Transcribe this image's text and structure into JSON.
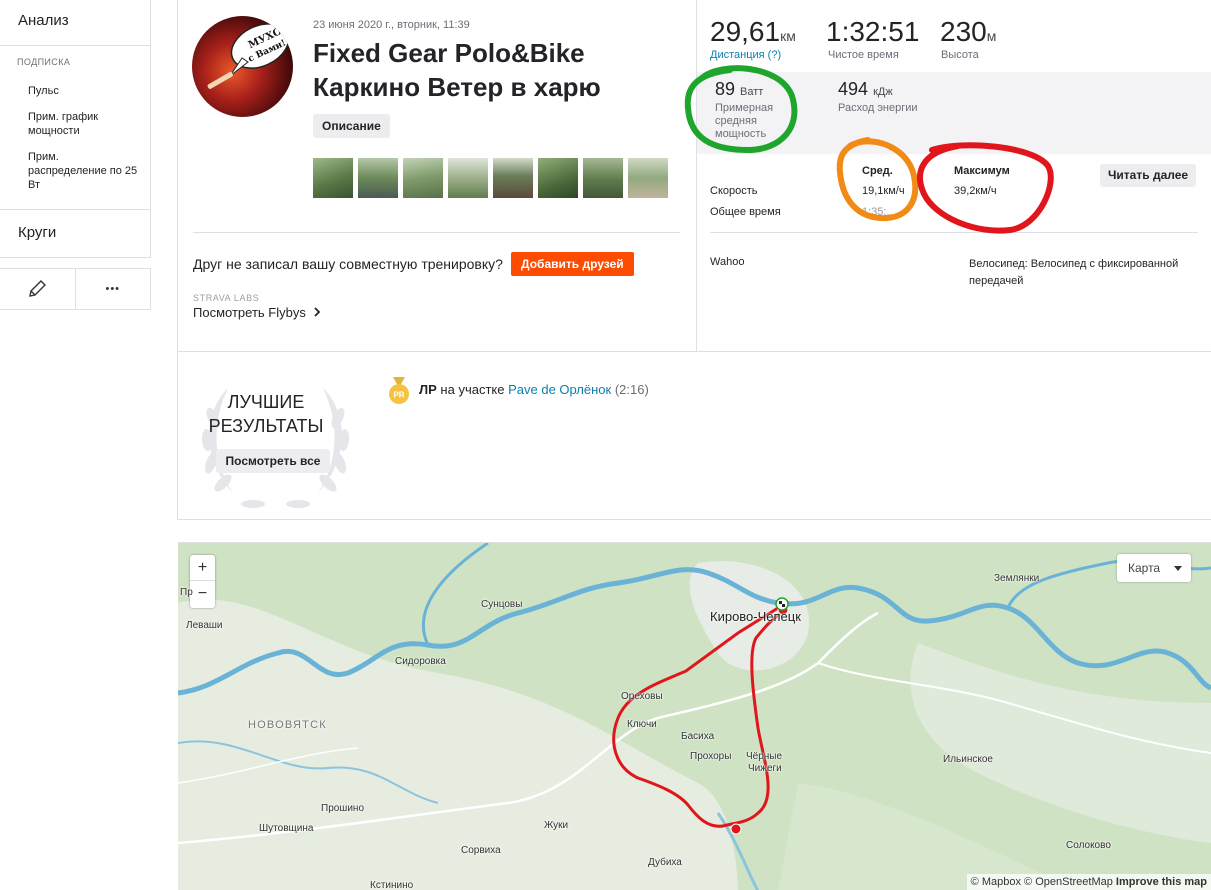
{
  "sidebar": {
    "analysis": "Анализ",
    "subscription_section": "ПОДПИСКА",
    "items": [
      {
        "label": "Пульс"
      },
      {
        "label": "Прим. график мощности"
      },
      {
        "label": "Прим. распределение по 25 Вт"
      }
    ],
    "laps": "Круги",
    "edit_icon": "pencil-icon",
    "more_icon": "ellipsis-icon",
    "more_text": "•••"
  },
  "activity": {
    "date": "23 июня 2020 г., вторник, 11:39",
    "title_line1": "Fixed Gear Polo&Bike",
    "title_line2": "Каркино Ветер в харю",
    "description_button": "Описание",
    "avatar_text": "МУХО с Вами!",
    "photo_count": 8
  },
  "friends": {
    "text": "Друг не записал вашу совместную тренировку?",
    "button": "Добавить друзей"
  },
  "flybys": {
    "label": "STRAVA LABS",
    "link": "Посмотреть Flybys"
  },
  "stats": {
    "distance": {
      "value": "29,61",
      "unit": "км",
      "label": "Дистанция (?)"
    },
    "moving_time": {
      "value": "1:32:51",
      "label": "Чистое время"
    },
    "elevation": {
      "value": "230",
      "unit": "м",
      "label": "Высота"
    },
    "power": {
      "value": "89",
      "unit": "Ватт",
      "label": "Примерная средняя мощность"
    },
    "energy": {
      "value": "494",
      "unit": "кДж",
      "label": "Расход энергии"
    }
  },
  "table": {
    "col_avg": "Сред.",
    "col_max": "Максимум",
    "read_more": "Читать далее",
    "rows": [
      {
        "label": "Скорость",
        "avg": "19,1км/ч",
        "max": "39,2км/ч"
      },
      {
        "label": "Общее время",
        "avg": "1:35:...",
        "max": ""
      }
    ]
  },
  "device": "Wahoo",
  "bike": "Велосипед: Велосипед с фиксированной передачей",
  "achievements": {
    "title": "ЛУЧШИЕ РЕЗУЛЬТАТЫ",
    "see_all": "Посмотреть все",
    "pr_badge": "PR",
    "pr_label": "ЛР",
    "pr_on": "на участке",
    "segment": "Pave de Орлёнок",
    "time": "(2:16)"
  },
  "map": {
    "zoom_in": "+",
    "zoom_out": "−",
    "type_select": "Карта",
    "places": {
      "leg": "Пр",
      "levashi": "Леваши",
      "suntsovy": "Сунцовы",
      "sidorovka": "Сидоровка",
      "novovyatsk": "НОВОВЯТСК",
      "kirovo": "Кирово-Чепецк",
      "zemlyanki": "Землянки",
      "orekhovy": "Ореховы",
      "klyuchi": "Ключи",
      "basikha": "Басиха",
      "prokhory": "Прохоры",
      "chyornye": "Чёрные",
      "chizhegi": "Чижеги",
      "ilinskoe": "Ильинское",
      "proshino": "Прошино",
      "shutovshchina": "Шутовщина",
      "zhuki": "Жуки",
      "sorvikha": "Сорвиха",
      "dubikha": "Дубиха",
      "solokovo": "Солоково",
      "kstinino": "Кстинино"
    },
    "attribution_mapbox": "© Mapbox",
    "attribution_osm": "© OpenStreetMap",
    "attribution_improve": "Improve this map"
  },
  "annotation_colors": {
    "green": "#1fa52b",
    "orange": "#f28a16",
    "red": "#e0161c"
  }
}
